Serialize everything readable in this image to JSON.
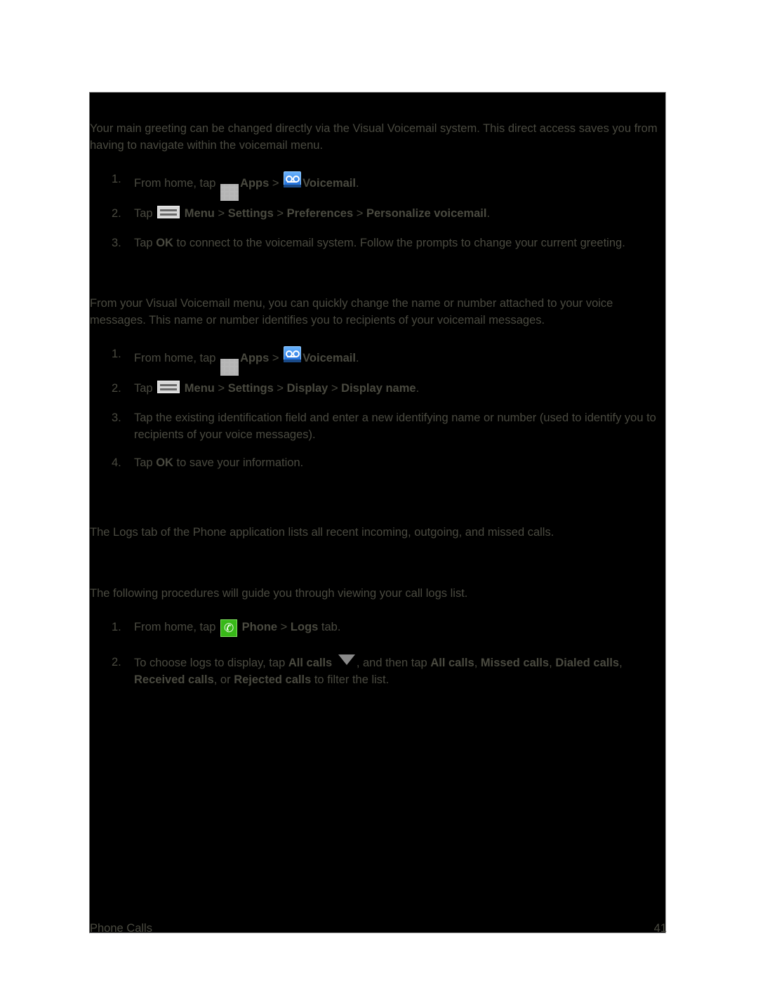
{
  "sections": [
    {
      "intro": "Your main greeting can be changed directly via the Visual Voicemail system. This direct access saves you from having to navigate within the voicemail menu.",
      "steps": [
        {
          "num": "1.",
          "parts": [
            "From home, tap",
            "Apps",
            ">",
            "Voicemail",
            "."
          ]
        },
        {
          "num": "2.",
          "parts": [
            "Tap",
            "Menu",
            ">",
            "Settings",
            ">",
            "Preferences",
            ">",
            "Personalize voicemail",
            "."
          ]
        },
        {
          "num": "3.",
          "parts": [
            "Tap",
            "OK",
            "to connect to the voicemail system. Follow the prompts to change your current greeting."
          ]
        }
      ]
    },
    {
      "intro": "From your Visual Voicemail menu, you can quickly change the name or number attached to your voice messages. This name or number identifies you to recipients of your voicemail messages.",
      "steps": [
        {
          "num": "1.",
          "parts": [
            "From home, tap",
            "Apps",
            ">",
            "Voicemail",
            "."
          ]
        },
        {
          "num": "2.",
          "parts": [
            "Tap",
            "Menu",
            ">",
            "Settings",
            ">",
            "Display",
            ">",
            "Display name",
            "."
          ]
        },
        {
          "num": "3.",
          "text": "Tap the existing identification field and enter a new identifying name or number (used to identify you to recipients of your voice messages)."
        },
        {
          "num": "4.",
          "parts": [
            "Tap",
            "OK",
            "to save your information."
          ]
        }
      ]
    },
    {
      "intro": "The Logs tab of the Phone application lists all recent incoming, outgoing, and missed calls."
    },
    {
      "intro": "The following procedures will guide you through viewing your call logs list.",
      "steps": [
        {
          "num": "1.",
          "parts": [
            "From home, tap",
            "Phone",
            ">",
            "Logs",
            "tab."
          ]
        },
        {
          "num": "2.",
          "parts": [
            "To choose logs to display, tap",
            "All calls",
            ", and then tap",
            "All calls",
            ",",
            "Missed calls",
            ",",
            "Dialed calls",
            ",",
            "Received calls",
            ", or",
            "Rejected calls",
            "to filter the list."
          ]
        }
      ]
    }
  ],
  "icons": {
    "apps": "apps-grid-icon",
    "voicemail": "voicemail-icon",
    "menu": "menu-icon",
    "phone": "phone-icon",
    "dropdown": "dropdown-triangle-icon",
    "phone_glyph": "✆"
  },
  "footer": {
    "section": "Phone Calls",
    "page": "41"
  },
  "colors": {
    "page_bg": "#000000",
    "text": "#4a4a40",
    "outer_bg": "#ffffff",
    "voicemail_icon": "#1a6ad8",
    "phone_icon": "#38b818"
  }
}
